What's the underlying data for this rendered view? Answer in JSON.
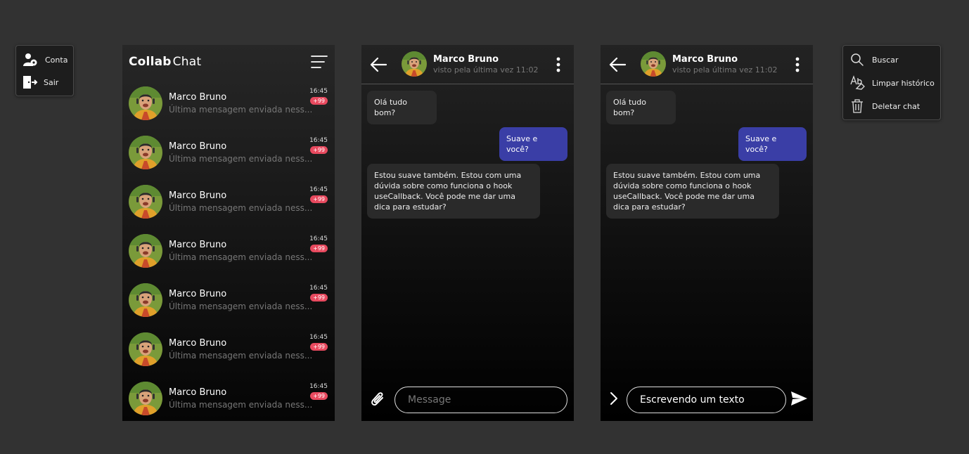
{
  "account_menu": {
    "items": [
      {
        "label": "Conta",
        "icon": "user-settings-icon"
      },
      {
        "label": "Sair",
        "icon": "logout-icon"
      }
    ]
  },
  "chat_list": {
    "logo_bold": "Collab",
    "logo_light": "Chat",
    "rows": [
      {
        "name": "Marco Bruno",
        "preview": "Última mensagem enviada ness...",
        "time": "16:45",
        "badge": "+99"
      },
      {
        "name": "Marco Bruno",
        "preview": "Última mensagem enviada ness...",
        "time": "16:45",
        "badge": "+99"
      },
      {
        "name": "Marco Bruno",
        "preview": "Última mensagem enviada ness...",
        "time": "16:45",
        "badge": "+99"
      },
      {
        "name": "Marco Bruno",
        "preview": "Última mensagem enviada ness...",
        "time": "16:45",
        "badge": "+99"
      },
      {
        "name": "Marco Bruno",
        "preview": "Última mensagem enviada ness...",
        "time": "16:45",
        "badge": "+99"
      },
      {
        "name": "Marco Bruno",
        "preview": "Última mensagem enviada ness...",
        "time": "16:45",
        "badge": "+99"
      },
      {
        "name": "Marco Bruno",
        "preview": "Última mensagem enviada ness...",
        "time": "16:45",
        "badge": "+99"
      }
    ]
  },
  "chat": {
    "contact_name": "Marco Bruno",
    "status": "visto pela última vez 11:02",
    "messages": [
      {
        "direction": "in",
        "text": "Olá tudo bom?"
      },
      {
        "direction": "out",
        "text": "Suave e você?"
      },
      {
        "direction": "in",
        "text": "Estou suave também. Estou com uma dúvida sobre como funciona o hook useCallback. Você pode me dar uma dica para estudar?"
      }
    ],
    "input_placeholder": "Message",
    "typed_text": "Escrevendo um texto"
  },
  "options_menu": {
    "items": [
      {
        "label": "Buscar",
        "icon": "search-icon"
      },
      {
        "label": "Limpar histórico",
        "icon": "clear-text-icon"
      },
      {
        "label": "Deletar chat",
        "icon": "trash-icon"
      }
    ]
  },
  "colors": {
    "background": "#323232",
    "outgoing_bubble": "#3a3ea6",
    "incoming_bubble": "#2a2a2a",
    "badge": "#e84a5f"
  }
}
